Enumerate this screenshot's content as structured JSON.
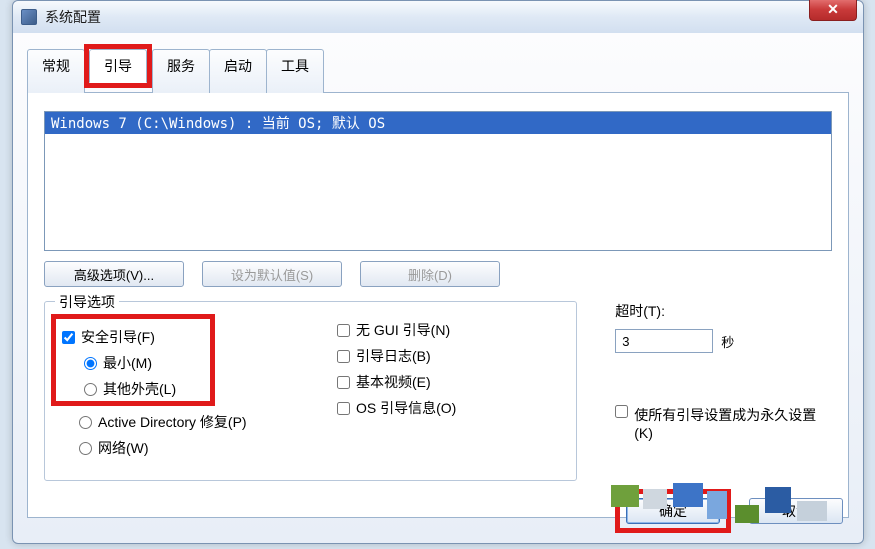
{
  "window": {
    "title": "系统配置",
    "close_glyph": "✕"
  },
  "tabs": [
    {
      "label": "常规"
    },
    {
      "label": "引导"
    },
    {
      "label": "服务"
    },
    {
      "label": "启动"
    },
    {
      "label": "工具"
    }
  ],
  "os_list": [
    {
      "text": "Windows 7 (C:\\Windows) : 当前 OS; 默认 OS",
      "selected": true
    }
  ],
  "buttons": {
    "advanced": "高级选项(V)...",
    "set_default": "设为默认值(S)",
    "delete": "删除(D)"
  },
  "boot_options": {
    "legend": "引导选项",
    "safe_boot": {
      "label": "安全引导(F)",
      "checked": true
    },
    "radios": {
      "minimal": "最小(M)",
      "altshell": "其他外壳(L)",
      "dsrepair": "Active Directory 修复(P)",
      "network": "网络(W)",
      "selected": "minimal"
    },
    "nogui": {
      "label": "无 GUI 引导(N)",
      "checked": false
    },
    "bootlog": {
      "label": "引导日志(B)",
      "checked": false
    },
    "basevideo": {
      "label": "基本视频(E)",
      "checked": false
    },
    "osinfo": {
      "label": "OS 引导信息(O)",
      "checked": false
    }
  },
  "timeout": {
    "label": "超时(T):",
    "value": "3",
    "unit": "秒"
  },
  "permanent": {
    "label": "使所有引导设置成为永久设置(K)",
    "checked": false
  },
  "dialog_buttons": {
    "ok": "确定",
    "cancel": "取消"
  }
}
